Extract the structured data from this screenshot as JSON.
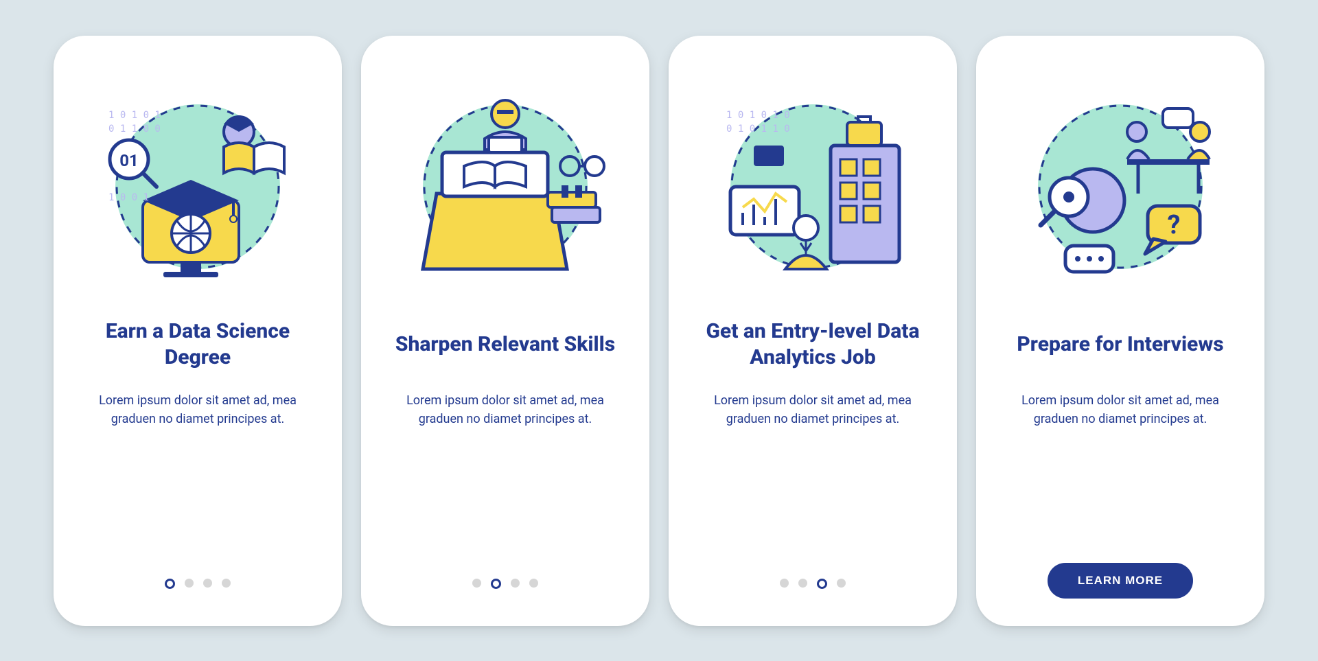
{
  "colors": {
    "primary": "#233a8f",
    "accentYellow": "#f7d94c",
    "accentMint": "#a8e6d3",
    "accentLilac": "#b9b8f0",
    "dotInactive": "#d6d6d6",
    "cardBg": "#ffffff",
    "pageBg": "#dbe5ea"
  },
  "cards": [
    {
      "title": "Earn a Data Science Degree",
      "body": "Lorem ipsum dolor sit amet ad, mea graduen no diamet principes at.",
      "icon": "degree-icon",
      "activeDot": 0
    },
    {
      "title": "Sharpen Relevant Skills",
      "body": "Lorem ipsum dolor sit amet ad, mea graduen no diamet principes at.",
      "icon": "skills-icon",
      "activeDot": 1
    },
    {
      "title": "Get an Entry-level Data Analytics Job",
      "body": "Lorem ipsum dolor sit amet ad, mea graduen no diamet principes at.",
      "icon": "job-icon",
      "activeDot": 2
    },
    {
      "title": "Prepare for Interviews",
      "body": "Lorem ipsum dolor sit amet ad, mea graduen no diamet principes at.",
      "icon": "interview-icon",
      "activeDot": 3,
      "cta": "LEARN MORE"
    }
  ],
  "dotsPerCard": 4
}
